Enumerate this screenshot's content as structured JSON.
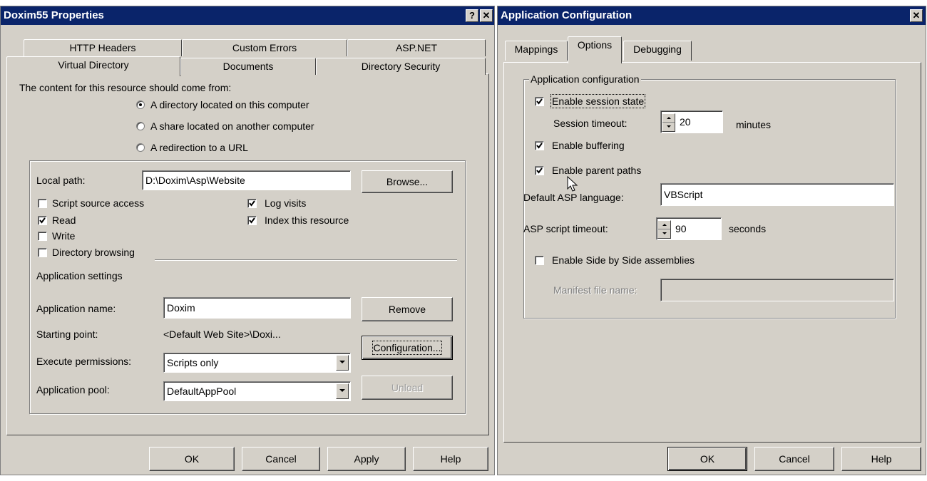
{
  "left": {
    "title": "Doxim55 Properties",
    "help_btn": "?",
    "close_btn": "✕",
    "tabs_row1": [
      "HTTP Headers",
      "Custom Errors",
      "ASP.NET"
    ],
    "tabs_row2": [
      "Virtual Directory",
      "Documents",
      "Directory Security"
    ],
    "content_from_label": "The content for this resource should come from:",
    "radios": [
      "A directory located on this computer",
      "A share located on another computer",
      "A redirection to a URL"
    ],
    "local_path_label": "Local path:",
    "local_path_value": "D:\\Doxim\\Asp\\Website",
    "browse": "Browse...",
    "checks": {
      "script_source": "Script source access",
      "read": "Read",
      "write": "Write",
      "dir_browsing": "Directory browsing",
      "log_visits": "Log visits",
      "index": "Index this resource"
    },
    "app_settings_label": "Application settings",
    "app_name_label": "Application name:",
    "app_name_value": "Doxim",
    "remove": "Remove",
    "starting_point_label": "Starting point:",
    "starting_point_value": "<Default Web Site>\\Doxi...",
    "configuration": "Configuration...",
    "exec_perm_label": "Execute permissions:",
    "exec_perm_value": "Scripts only",
    "app_pool_label": "Application pool:",
    "app_pool_value": "DefaultAppPool",
    "unload": "Unload",
    "ok": "OK",
    "cancel": "Cancel",
    "apply": "Apply",
    "help": "Help"
  },
  "right": {
    "title": "Application Configuration",
    "close_btn": "✕",
    "tabs": [
      "Mappings",
      "Options",
      "Debugging"
    ],
    "group_label": "Application configuration",
    "enable_session": "Enable session state",
    "session_timeout_label": "Session timeout:",
    "session_timeout_value": "20",
    "minutes": "minutes",
    "enable_buffering": "Enable buffering",
    "enable_parent_paths": "Enable parent paths",
    "default_lang_label": "Default ASP language:",
    "default_lang_value": "VBScript",
    "script_timeout_label": "ASP script timeout:",
    "script_timeout_value": "90",
    "seconds": "seconds",
    "side_by_side": "Enable Side by Side assemblies",
    "manifest_label": "Manifest file name:",
    "manifest_value": "",
    "ok": "OK",
    "cancel": "Cancel",
    "help": "Help"
  },
  "colors": {
    "titlebar": "#0a246a",
    "face": "#d4d0c8"
  }
}
